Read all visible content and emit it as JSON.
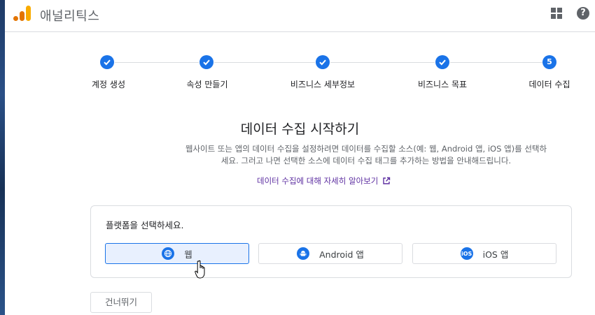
{
  "app": {
    "title": "애널리틱스",
    "logo_icon": "analytics-logo-icon",
    "apps_icon": "apps-grid-icon",
    "help_icon": "help-icon"
  },
  "stepper": {
    "steps": [
      {
        "label": "계정 생성",
        "status": "done"
      },
      {
        "label": "속성 만들기",
        "status": "done"
      },
      {
        "label": "비즈니스 세부정보",
        "status": "done"
      },
      {
        "label": "비즈니스 목표",
        "status": "done"
      },
      {
        "label": "데이터 수집",
        "status": "current",
        "number": "5"
      }
    ]
  },
  "main": {
    "title": "데이터 수집 시작하기",
    "description": "웹사이트 또는 앱의 데이터 수집을 설정하려면 데이터를 수집할 소스(예: 웹, Android 앱, iOS 앱)를 선택하세요. 그러고 나면 선택한 소스에 데이터 수집 태그를 추가하는 방법을 안내해드립니다.",
    "learn_more": "데이터 수집에 대해 자세히 알아보기"
  },
  "platform_card": {
    "title": "플랫폼을 선택하세요.",
    "options": [
      {
        "label": "웹",
        "icon": "globe-icon",
        "selected": true
      },
      {
        "label": "Android 앱",
        "icon": "android-icon",
        "selected": false
      },
      {
        "label": "iOS 앱",
        "icon": "ios-icon",
        "selected": false
      }
    ]
  },
  "skip_button": "건너뛰기",
  "colors": {
    "accent": "#1a73e8",
    "link": "#5d2fa1",
    "selected_bg": "#e8f0fe",
    "logo_orange": "#f9ab00",
    "logo_dark_orange": "#e37400"
  }
}
